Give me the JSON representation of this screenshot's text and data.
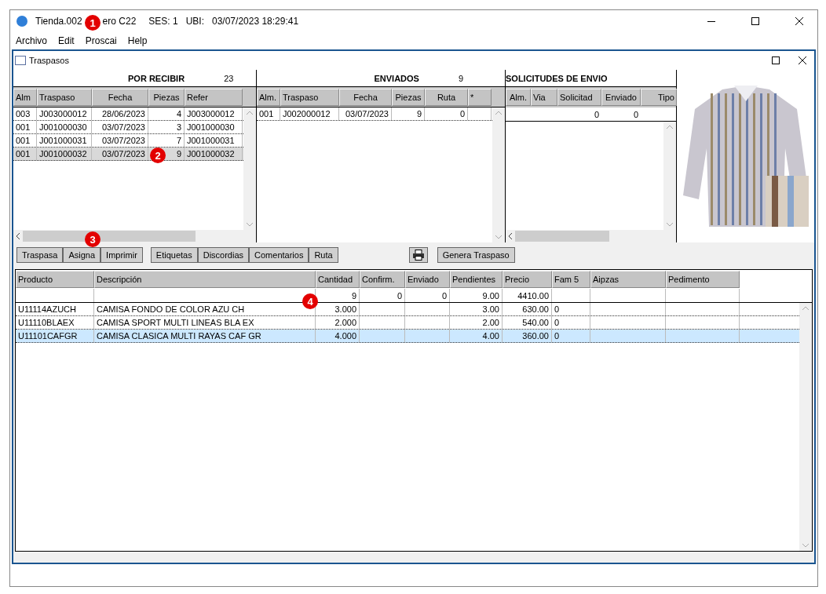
{
  "window": {
    "title_parts": [
      "Tienda.002",
      "ero C22",
      "SES: 1",
      "UBI:",
      "03/07/2023 18:29:41"
    ]
  },
  "menu": [
    "Archivo",
    "Edit",
    "Proscai",
    "Help"
  ],
  "callouts": [
    "1",
    "2",
    "3",
    "4"
  ],
  "child_window": {
    "title": "Traspasos"
  },
  "por_recibir": {
    "title": "POR RECIBIR",
    "count": "23",
    "columns": [
      "Alm",
      "Traspaso",
      "Fecha",
      "Piezas",
      "Refer"
    ],
    "rows": [
      {
        "cells": [
          "003",
          "J003000012",
          "28/06/2023",
          "4",
          "J003000012"
        ],
        "selected": false
      },
      {
        "cells": [
          "001",
          "J001000030",
          "03/07/2023",
          "3",
          "J001000030"
        ],
        "selected": false
      },
      {
        "cells": [
          "001",
          "J001000031",
          "03/07/2023",
          "7",
          "J001000031"
        ],
        "selected": false
      },
      {
        "cells": [
          "001",
          "J001000032",
          "03/07/2023",
          "9",
          "J001000032"
        ],
        "selected": true
      }
    ]
  },
  "enviados": {
    "title": "ENVIADOS",
    "count": "9",
    "columns": [
      "Alm.",
      "Traspaso",
      "Fecha",
      "Piezas",
      "Ruta",
      "*"
    ],
    "rows": [
      {
        "cells": [
          "001",
          "J002000012",
          "03/07/2023",
          "9",
          "0",
          null
        ],
        "selected": false
      }
    ]
  },
  "solicitudes": {
    "title": "SOLICITUDES DE ENVIO",
    "columns": [
      "Alm.",
      "Via",
      "Solicitad",
      "Enviado",
      "Tipo"
    ],
    "totals": {
      "solicitado": "0",
      "enviado": "0"
    }
  },
  "product_image": {
    "kind": "picture"
  },
  "toolbar": [
    {
      "label": "Traspasa",
      "kind": "button"
    },
    {
      "label": "Asigna",
      "kind": "button"
    },
    {
      "label": "Imprimir",
      "kind": "button"
    },
    {
      "kind": "gap"
    },
    {
      "label": "Etiquetas",
      "kind": "button"
    },
    {
      "label": "Discordias",
      "kind": "button"
    },
    {
      "label": "Comentarios",
      "kind": "button"
    },
    {
      "label": "Ruta",
      "kind": "button"
    },
    {
      "kind": "spacer"
    },
    {
      "kind": "print"
    },
    {
      "label": "Genera Traspaso",
      "kind": "button"
    }
  ],
  "detail": {
    "columns": [
      "Producto",
      "Descripción",
      "Cantidad",
      "Confirm.",
      "Enviado",
      "Pendientes",
      "Precio",
      "Fam 5",
      "Aipzas",
      "Pedimento"
    ],
    "totals": {
      "cantidad": "9",
      "confirm": "0",
      "enviado": "0",
      "pendientes": "9.00",
      "precio": "4410.00"
    },
    "rows": [
      {
        "cells": [
          "U11114AZUCH",
          "CAMISA FONDO DE COLOR AZU CH",
          "3.000",
          null,
          null,
          "3.00",
          "630.00",
          "0",
          null,
          null
        ],
        "selected": false
      },
      {
        "cells": [
          "U11110BLAEX",
          "CAMISA SPORT MULTI LINEAS BLA EX",
          "2.000",
          null,
          null,
          "2.00",
          "540.00",
          "0",
          null,
          null
        ],
        "selected": false
      },
      {
        "cells": [
          "U11101CAFGR",
          "CAMISA CLASICA MULTI RAYAS CAF GR",
          "4.000",
          null,
          null,
          "4.00",
          "360.00",
          "0",
          null,
          null
        ],
        "selected": true
      }
    ]
  }
}
